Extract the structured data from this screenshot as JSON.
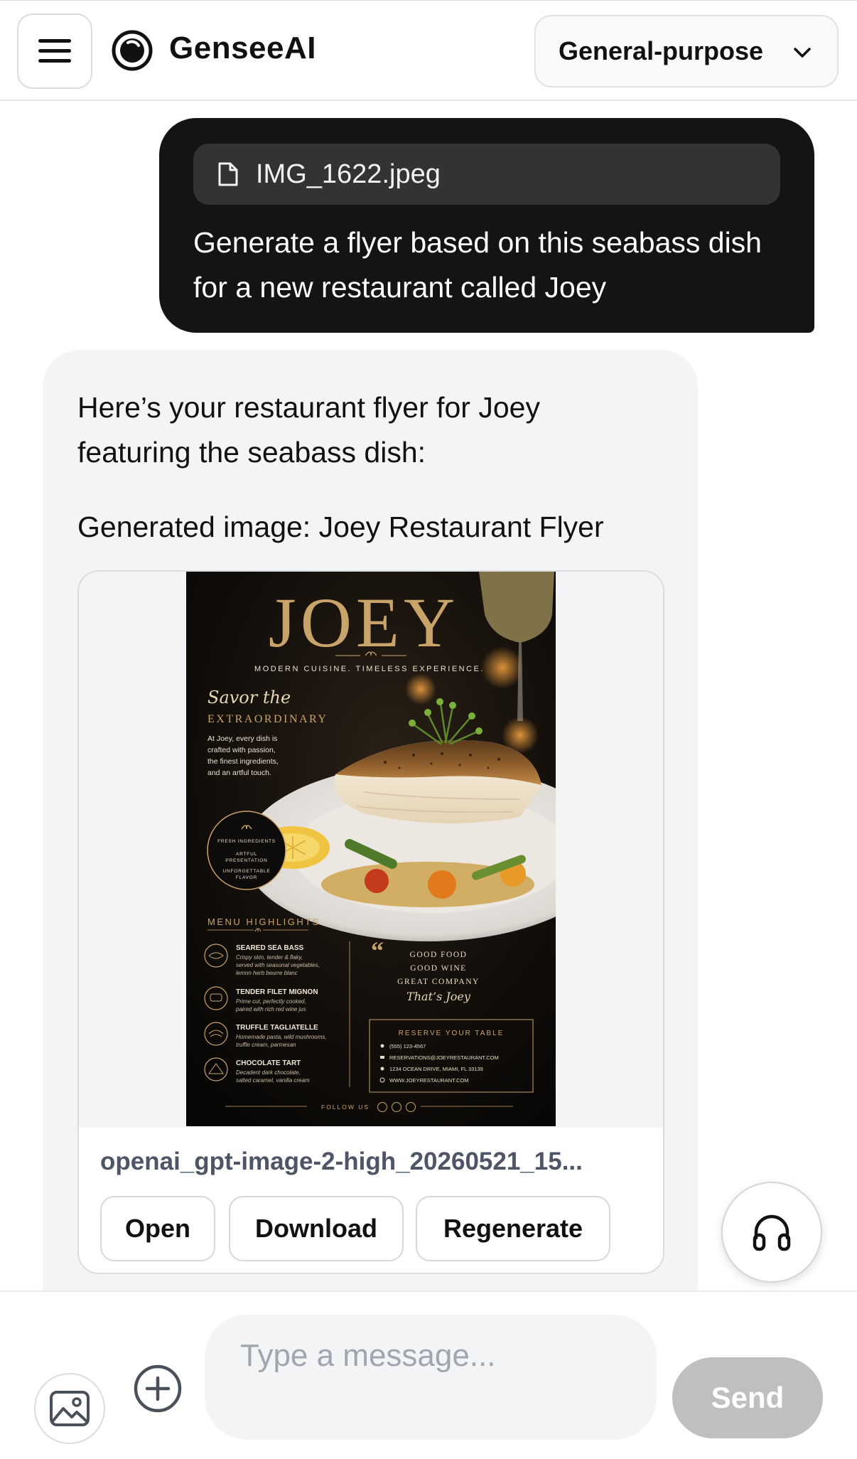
{
  "header": {
    "menu_icon": "hamburger-menu-icon",
    "logo_icon": "gensee-logo-icon",
    "brand": "GenseeAI",
    "model_select": {
      "selected": "General-purpose",
      "icon": "chevron-down-icon"
    }
  },
  "user_message": {
    "attachment": {
      "icon": "file-icon",
      "filename": "IMG_1622.jpeg"
    },
    "text": "Generate a flyer based on this seabass dish for a new restaurant called Joey"
  },
  "assistant_message": {
    "intro": "Here’s your restaurant flyer for Joey featuring the seabass dish:",
    "caption": "Generated image: Joey Restaurant Flyer",
    "image_card": {
      "filename": "openai_gpt-image-2-high_20260521_15...",
      "buttons": {
        "open": "Open",
        "download": "Download",
        "regenerate": "Regenerate"
      }
    },
    "flyer": {
      "title": "JOEY",
      "tagline": "MODERN CUISINE. TIMELESS EXPERIENCE.",
      "script_heading": "Savor the",
      "heading": "EXTRAORDINARY",
      "description": [
        "At Joey, every dish is",
        "crafted with passion,",
        "the finest ingredients,",
        "and an artful touch."
      ],
      "badge": [
        "FRESH INGREDIENTS",
        "ARTFUL",
        "PRESENTATION",
        "UNFORGETTABLE",
        "FLAVOR"
      ],
      "menu_title": "MENU HIGHLIGHTS",
      "menu": [
        {
          "name": "SEARED SEA BASS",
          "desc1": "Crispy skin, tender & flaky,",
          "desc2": "served with seasonal vegetables,",
          "desc3": "lemon herb beurre blanc"
        },
        {
          "name": "TENDER FILET MIGNON",
          "desc1": "Prime cut, perfectly cooked,",
          "desc2": "paired with rich red wine jus",
          "desc3": ""
        },
        {
          "name": "TRUFFLE TAGLIATELLE",
          "desc1": "Homemade pasta, wild mushrooms,",
          "desc2": "truffle cream, parmesan",
          "desc3": ""
        },
        {
          "name": "CHOCOLATE TART",
          "desc1": "Decadent dark chocolate,",
          "desc2": "salted caramel, vanilla cream",
          "desc3": ""
        }
      ],
      "quote": [
        "GOOD FOOD",
        "GOOD WINE",
        "GREAT COMPANY"
      ],
      "quote_signature": "That’s Joey",
      "reserve_title": "RESERVE YOUR TABLE",
      "contacts": [
        "(555) 123-4567",
        "RESERVATIONS@JOEYRESTAURANT.COM",
        "1234 OCEAN DRIVE, MIAMI, FL 33139",
        "WWW.JOEYRESTAURANT.COM"
      ],
      "follow": "FOLLOW US"
    }
  },
  "audio_button": {
    "icon": "headphones-icon"
  },
  "composer": {
    "image_icon": "image-icon",
    "plus_icon": "plus-circle-icon",
    "placeholder": "Type a message...",
    "send_label": "Send"
  },
  "colors": {
    "user_bubble": "#141414",
    "assistant_bubble": "#f3f4f6",
    "flyer_gold": "#c9a46a",
    "send_disabled": "#bfbfbf"
  }
}
